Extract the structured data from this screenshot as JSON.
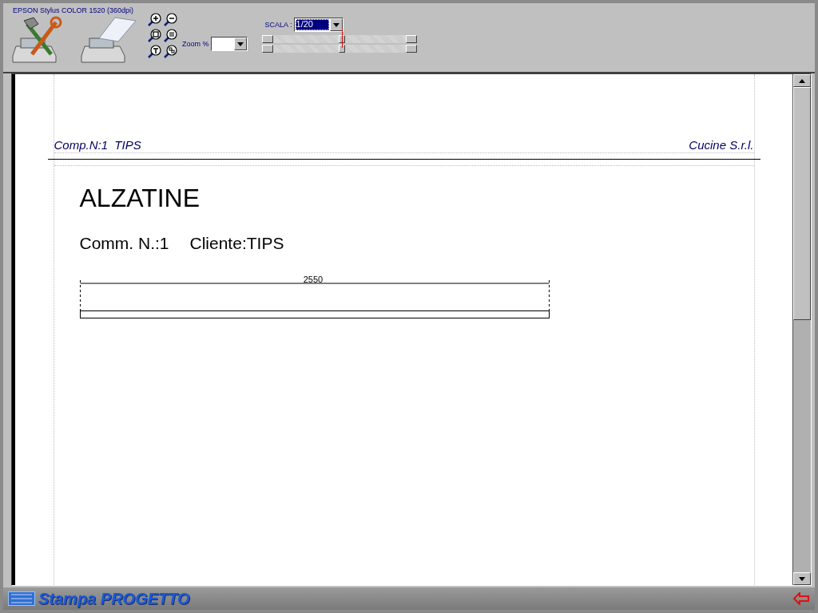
{
  "printer": "EPSON Stylus COLOR 1520 (360dpi)",
  "zoom": {
    "label": "Zoom %"
  },
  "scale": {
    "label": "SCALA :",
    "value": "1/20"
  },
  "sliders": [
    {
      "level": 0.52
    },
    {
      "level": 0.52
    }
  ],
  "document": {
    "header_left": "Comp.N:1  TIPS",
    "header_right": "Cucine S.r.l.",
    "title": "ALZATINE",
    "line_1": "Comm. N.:1",
    "line_2": "Cliente:TIPS",
    "dimension": "2550"
  },
  "footer": {
    "title": "Stampa PROGETTO"
  }
}
